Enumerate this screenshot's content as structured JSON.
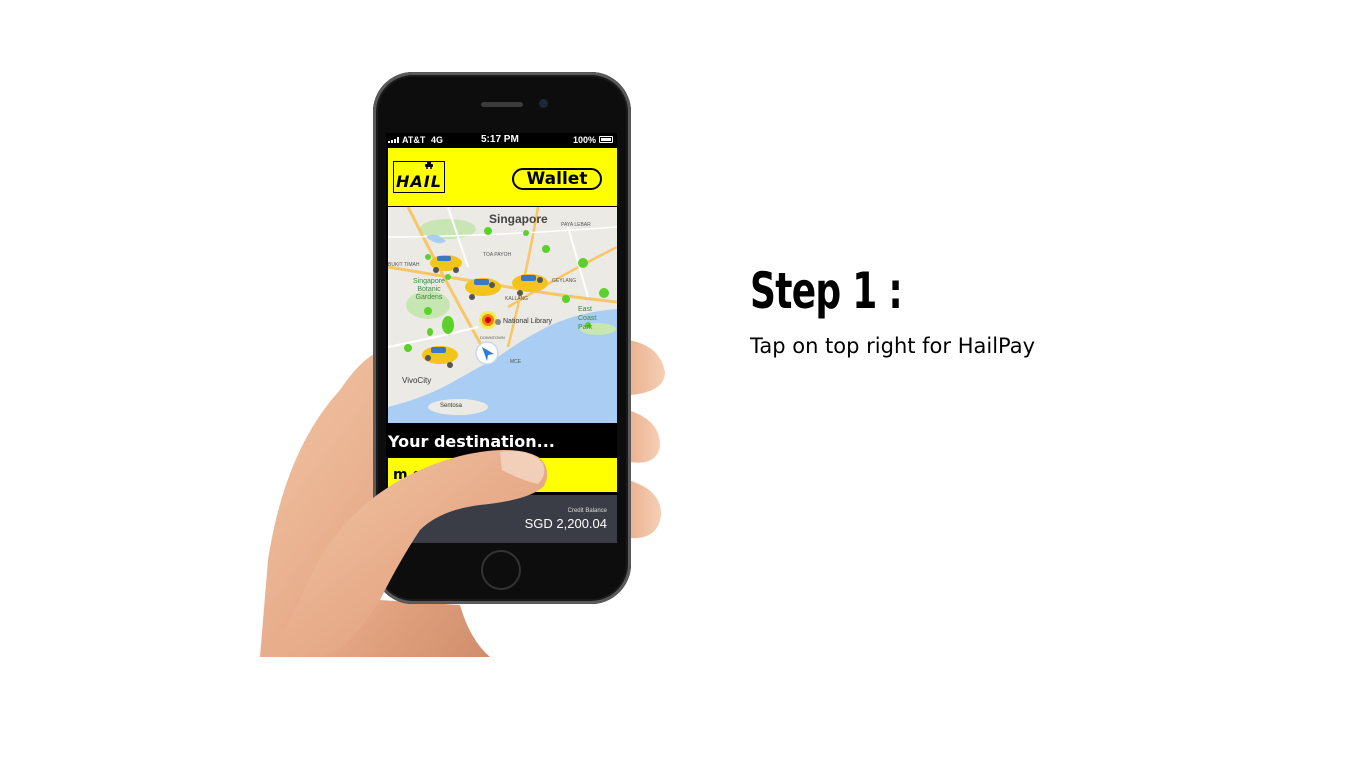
{
  "slide": {
    "step_title": "Step 1 :",
    "step_description": "Tap on top right for HailPay"
  },
  "phone": {
    "status_bar": {
      "carrier": "AT&T",
      "network": "4G",
      "time": "5:17 PM",
      "battery": "100%"
    },
    "app_bar": {
      "logo_text": "HAIL",
      "wallet_label": "Wallet"
    },
    "map": {
      "city_label": "Singapore",
      "labels": {
        "paya_lebar": "PAYA LEBAR",
        "toa_payoh": "TOA PAYOH",
        "bukit_timah": "BUKIT TIMAH",
        "geylang": "GEYLANG",
        "kallang": "KALLANG",
        "botanic": "Singapore Botanic Gardens",
        "national_library": "National Library",
        "east_coast": "East Coast Park",
        "downtown": "DOWNTOWN",
        "vivocity": "VivoCity",
        "sentosa": "Sentosa",
        "mce": "MCE"
      }
    },
    "destination": {
      "title": "Your destination...",
      "value": "m goi"
    },
    "balance": {
      "label": "Credit Balance",
      "value": "SGD 2,200.04"
    }
  },
  "colors": {
    "brand_yellow": "#ffff00",
    "balance_bg": "#3a3d46",
    "water": "#a9cdf3",
    "park_green": "#c8e6b4",
    "marker_green": "#5ad22a"
  }
}
